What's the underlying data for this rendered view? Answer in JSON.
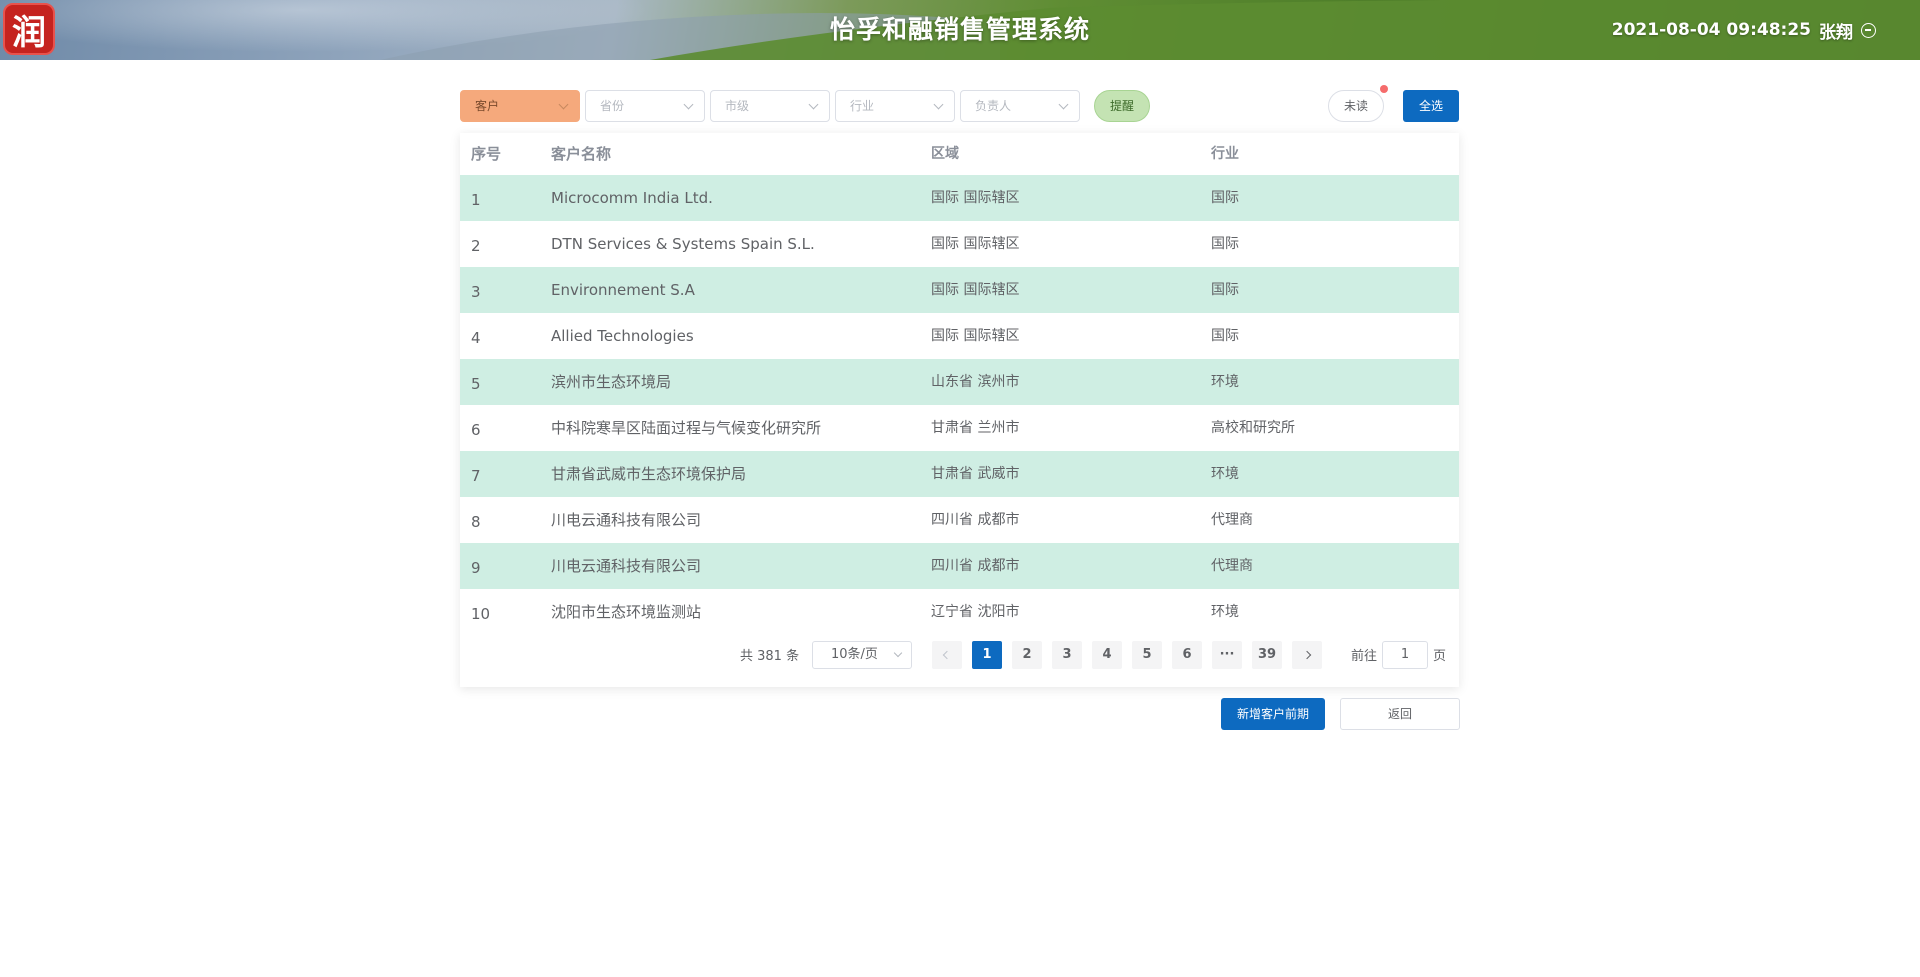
{
  "header": {
    "logo_char": "润",
    "title": "怡孚和融销售管理系统",
    "datetime": "2021-08-04 09:48:25",
    "user": "张翔"
  },
  "filters": {
    "customer": "客户",
    "province": "省份",
    "city": "市级",
    "industry": "行业",
    "owner": "负责人",
    "remind": "提醒",
    "unread": "未读",
    "select_all": "全选"
  },
  "table": {
    "columns": [
      "序号",
      "客户名称",
      "区域",
      "行业"
    ],
    "rows": [
      {
        "idx": "1",
        "name": "Microcomm India Ltd.",
        "region": "国际 国际辖区",
        "industry": "国际"
      },
      {
        "idx": "2",
        "name": "DTN Services & Systems Spain S.L.",
        "region": "国际 国际辖区",
        "industry": "国际"
      },
      {
        "idx": "3",
        "name": "Environnement S.A",
        "region": "国际 国际辖区",
        "industry": "国际"
      },
      {
        "idx": "4",
        "name": "Allied Technologies",
        "region": "国际 国际辖区",
        "industry": "国际"
      },
      {
        "idx": "5",
        "name": "滨州市生态环境局",
        "region": "山东省 滨州市",
        "industry": "环境"
      },
      {
        "idx": "6",
        "name": "中科院寒旱区陆面过程与气候变化研究所",
        "region": "甘肃省 兰州市",
        "industry": "高校和研究所"
      },
      {
        "idx": "7",
        "name": "甘肃省武威市生态环境保护局",
        "region": "甘肃省 武威市",
        "industry": "环境"
      },
      {
        "idx": "8",
        "name": "川电云通科技有限公司",
        "region": "四川省 成都市",
        "industry": "代理商"
      },
      {
        "idx": "9",
        "name": "川电云通科技有限公司",
        "region": "四川省 成都市",
        "industry": "代理商"
      },
      {
        "idx": "10",
        "name": "沈阳市生态环境监测站",
        "region": "辽宁省 沈阳市",
        "industry": "环境"
      }
    ]
  },
  "pagination": {
    "total": "共 381 条",
    "page_size": "10条/页",
    "pages": [
      "1",
      "2",
      "3",
      "4",
      "5",
      "6",
      "···",
      "39"
    ],
    "current": "1",
    "goto_label": "前往",
    "goto_value": "1",
    "goto_unit": "页"
  },
  "actions": {
    "add": "新增客户前期",
    "back": "返回"
  },
  "colors": {
    "primary": "#0d6ac0",
    "row_highlight": "#cfeee3",
    "customer_filter": "#f5a97c",
    "remind": "#c4e3b3",
    "badge": "#f56c6c"
  }
}
